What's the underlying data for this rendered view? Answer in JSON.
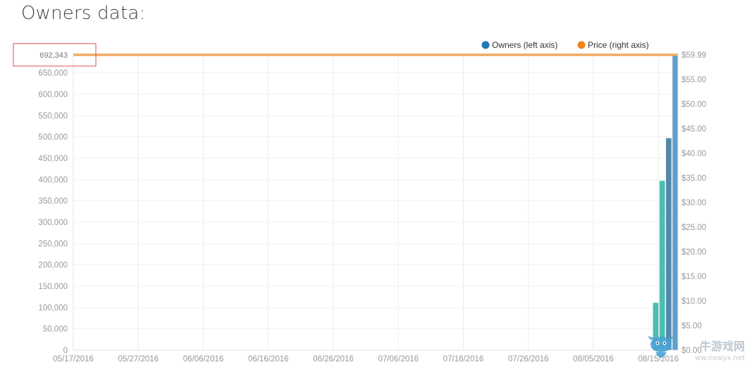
{
  "page": {
    "title": "Owners data:"
  },
  "chart_data": {
    "type": "bar",
    "x_labels": [
      "05/17/2016",
      "05/27/2016",
      "06/06/2016",
      "06/16/2016",
      "06/26/2016",
      "07/06/2016",
      "07/16/2016",
      "07/26/2016",
      "08/05/2016",
      "08/15/2016"
    ],
    "xlim": [
      "05/17/2016",
      "08/18/2016"
    ],
    "left_axis": {
      "ylim": [
        0,
        700000
      ],
      "ticks": [
        "0",
        "50,000",
        "100,000",
        "150,000",
        "200,000",
        "250,000",
        "300,000",
        "350,000",
        "400,000",
        "450,000",
        "500,000",
        "550,000",
        "600,000",
        "650,000"
      ]
    },
    "right_axis": {
      "ylim": [
        0,
        59.99
      ],
      "ticks": [
        "$0.00",
        "$5.00",
        "$10.00",
        "$15.00",
        "$20.00",
        "$25.00",
        "$30.00",
        "$35.00",
        "$40.00",
        "$45.00",
        "$50.00",
        "$55.00",
        "$59.99"
      ]
    },
    "series": [
      {
        "name": "Owners (left axis)",
        "color": "#1f77b4",
        "points": [
          {
            "x": "08/15/2016",
            "y": 111000,
            "color": "#4cbdb2"
          },
          {
            "x": "08/16/2016",
            "y": 397000,
            "color": "#4cbdb2"
          },
          {
            "x": "08/17/2016",
            "y": 497000,
            "color": "#5588aa"
          },
          {
            "x": "08/18/2016",
            "y": 692343,
            "color": "#5fa0cc"
          }
        ]
      },
      {
        "name": "Price (right axis)",
        "color": "#f5821f",
        "line_color": "#f0a860",
        "points": [
          {
            "x": "05/17/2016",
            "y": 59.99
          },
          {
            "x": "08/18/2016",
            "y": 59.99
          }
        ]
      }
    ],
    "peak_label": "692,343",
    "grid": true,
    "legend": "top-right"
  },
  "watermark": {
    "text": "牛游戏网",
    "sub": "ww.newyx.net"
  }
}
